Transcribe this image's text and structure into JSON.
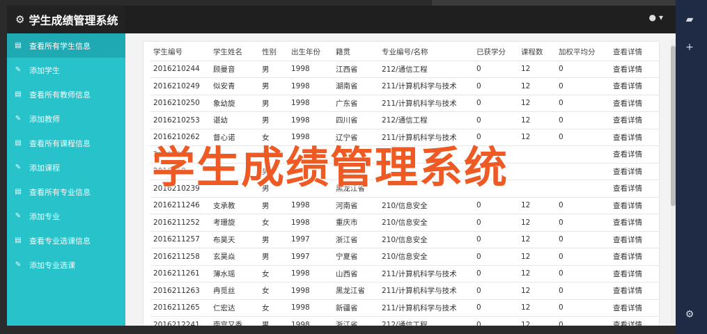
{
  "app": {
    "title": "学生成绩管理系统"
  },
  "overlay": {
    "text": "学生成绩管理系统"
  },
  "sidebar": {
    "items": [
      {
        "label": "查看所有学生信息",
        "icon": "table-icon",
        "active": true
      },
      {
        "label": "添加学生",
        "icon": "edit-icon",
        "active": false
      },
      {
        "label": "查看所有教师信息",
        "icon": "table-icon",
        "active": false
      },
      {
        "label": "添加教师",
        "icon": "edit-icon",
        "active": false
      },
      {
        "label": "查看所有课程信息",
        "icon": "table-icon",
        "active": false
      },
      {
        "label": "添加课程",
        "icon": "edit-icon",
        "active": false
      },
      {
        "label": "查看所有专业信息",
        "icon": "table-icon",
        "active": false
      },
      {
        "label": "添加专业",
        "icon": "edit-icon",
        "active": false
      },
      {
        "label": "查看专业选课信息",
        "icon": "table-icon",
        "active": false
      },
      {
        "label": "添加专业选课",
        "icon": "edit-icon",
        "active": false
      }
    ]
  },
  "table": {
    "headers": [
      "学生编号",
      "学生姓名",
      "性别",
      "出生年份",
      "籍贯",
      "专业编号/名称",
      "已获学分",
      "课程数",
      "加权平均分",
      "查看详情"
    ],
    "rows": [
      [
        "2016210244",
        "顾曼音",
        "男",
        "1998",
        "江西省",
        "212/通信工程",
        "0",
        "12",
        "0",
        "查看详情"
      ],
      [
        "2016210249",
        "似安青",
        "男",
        "1998",
        "湖南省",
        "211/计算机科学与技术",
        "0",
        "12",
        "0",
        "查看详情"
      ],
      [
        "2016210250",
        "象幼旋",
        "男",
        "1998",
        "广东省",
        "211/计算机科学与技术",
        "0",
        "12",
        "0",
        "查看详情"
      ],
      [
        "2016210253",
        "谌幼",
        "男",
        "1998",
        "四川省",
        "212/通信工程",
        "0",
        "12",
        "0",
        "查看详情"
      ],
      [
        "2016210262",
        "督心诺",
        "女",
        "1998",
        "辽宁省",
        "211/计算机科学与技术",
        "0",
        "12",
        "0",
        "查看详情"
      ],
      [
        "2016210...",
        "",
        "男",
        "",
        "",
        "",
        "",
        "",
        "",
        "查看详情"
      ],
      [
        "2016210...",
        "",
        "男",
        "",
        "",
        "",
        "",
        "",
        "",
        "查看详情"
      ],
      [
        "2016210239",
        "",
        "男",
        "",
        "黑龙江省",
        "",
        "",
        "",
        "",
        "查看详情"
      ],
      [
        "2016211246",
        "支承教",
        "男",
        "1998",
        "河南省",
        "210/信息安全",
        "0",
        "12",
        "0",
        "查看详情"
      ],
      [
        "2016211252",
        "考珊旋",
        "女",
        "1998",
        "重庆市",
        "210/信息安全",
        "0",
        "12",
        "0",
        "查看详情"
      ],
      [
        "2016211257",
        "布昊天",
        "男",
        "1997",
        "浙江省",
        "210/信息安全",
        "0",
        "12",
        "0",
        "查看详情"
      ],
      [
        "2016211258",
        "玄昊焱",
        "男",
        "1997",
        "宁夏省",
        "210/信息安全",
        "0",
        "12",
        "0",
        "查看详情"
      ],
      [
        "2016211261",
        "薄水瑶",
        "女",
        "1998",
        "山西省",
        "211/计算机科学与技术",
        "0",
        "12",
        "0",
        "查看详情"
      ],
      [
        "2016211263",
        "冉觅丝",
        "女",
        "1998",
        "黑龙江省",
        "211/计算机科学与技术",
        "0",
        "12",
        "0",
        "查看详情"
      ],
      [
        "2016211265",
        "仁宏达",
        "女",
        "1998",
        "新疆省",
        "211/计算机科学与技术",
        "0",
        "12",
        "0",
        "查看详情"
      ],
      [
        "2016212241",
        "南宫又香",
        "男",
        "1998",
        "浙江省",
        "212/通信工程",
        "0",
        "12",
        "0",
        "查看详情"
      ]
    ]
  }
}
